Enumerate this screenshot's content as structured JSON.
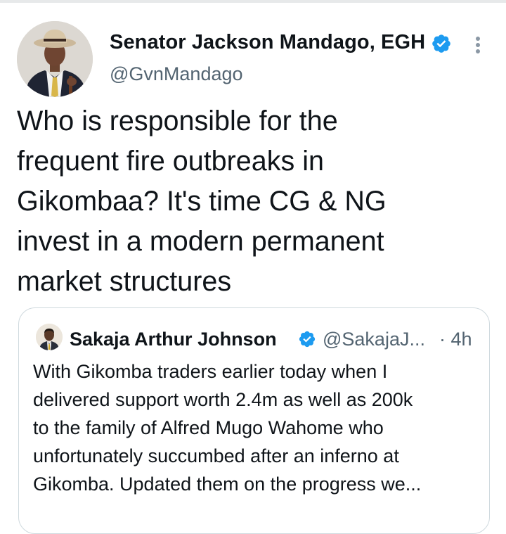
{
  "tweet": {
    "author": {
      "name": "Senator Jackson Mandago, EGH",
      "handle": "@GvnMandago",
      "avatar_icon": "profile-photo-man-in-hat-and-suit",
      "verified": true
    },
    "text": "Who is responsible for the\nfrequent fire outbreaks in\nGikombaa? It's time CG & NG\ninvest in a modern permanent\nmarket structures",
    "more_icon": "vertical-ellipsis-icon"
  },
  "quoted_tweet": {
    "author": {
      "name": "Sakaja Arthur Johnson",
      "handle": "@SakajaJ...",
      "avatar_icon": "profile-photo-man-in-suit",
      "verified": true
    },
    "time": "· 4h",
    "text": "With Gikomba traders earlier today when I\ndelivered support worth 2.4m as well as 200k\nto the family of Alfred Mugo Wahome who\nunfortunately succumbed after an inferno at\nGikomba. Updated them on the progress we..."
  },
  "colors": {
    "verified_blue": "#1d9bf0",
    "text_primary": "#0f1419",
    "text_secondary": "#536471",
    "border": "#cfd9de"
  }
}
